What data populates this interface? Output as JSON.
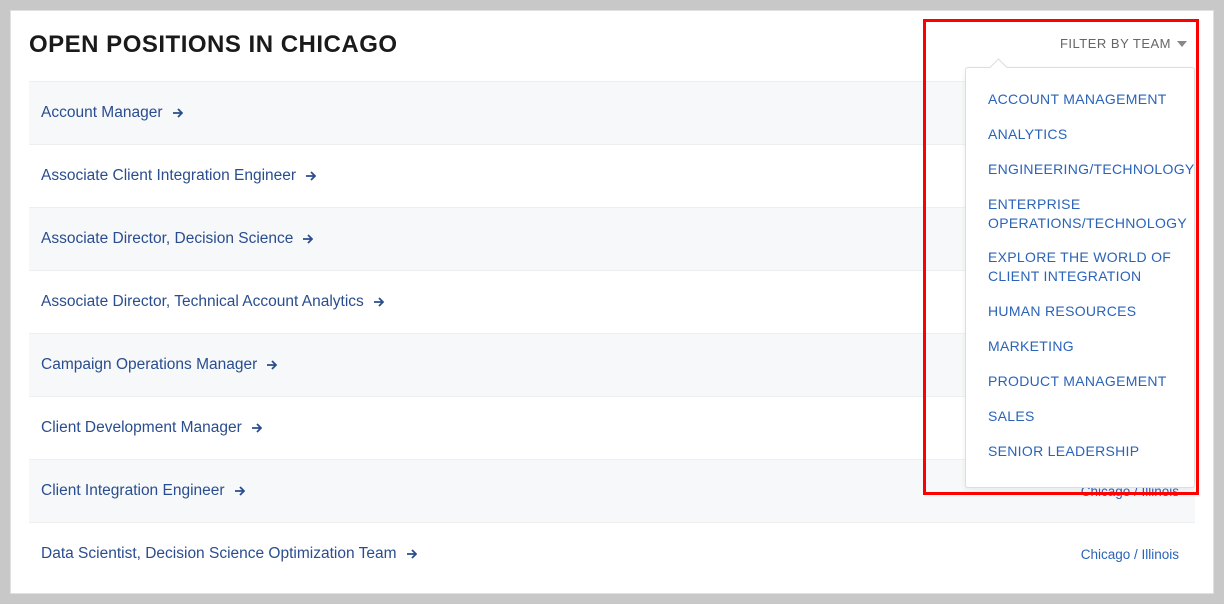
{
  "header": {
    "title": "OPEN POSITIONS IN CHICAGO"
  },
  "filter": {
    "label": "FILTER BY TEAM",
    "options": [
      "ACCOUNT MANAGEMENT",
      "ANALYTICS",
      "ENGINEERING/TECHNOLOGY",
      "ENTERPRISE OPERATIONS/TECHNOLOGY",
      "EXPLORE THE WORLD OF CLIENT INTEGRATION",
      "HUMAN RESOURCES",
      "MARKETING",
      "PRODUCT MANAGEMENT",
      "SALES",
      "SENIOR LEADERSHIP"
    ]
  },
  "positions": [
    {
      "title": "Account Manager",
      "location": ""
    },
    {
      "title": "Associate Client Integration Engineer",
      "location": ""
    },
    {
      "title": "Associate Director, Decision Science",
      "location": ""
    },
    {
      "title": "Associate Director, Technical Account Analytics",
      "location": ""
    },
    {
      "title": "Campaign Operations Manager",
      "location": ""
    },
    {
      "title": "Client Development Manager",
      "location": ""
    },
    {
      "title": "Client Integration Engineer",
      "location": "Chicago / Illinois"
    },
    {
      "title": "Data Scientist, Decision Science Optimization Team",
      "location": "Chicago / Illinois"
    }
  ]
}
